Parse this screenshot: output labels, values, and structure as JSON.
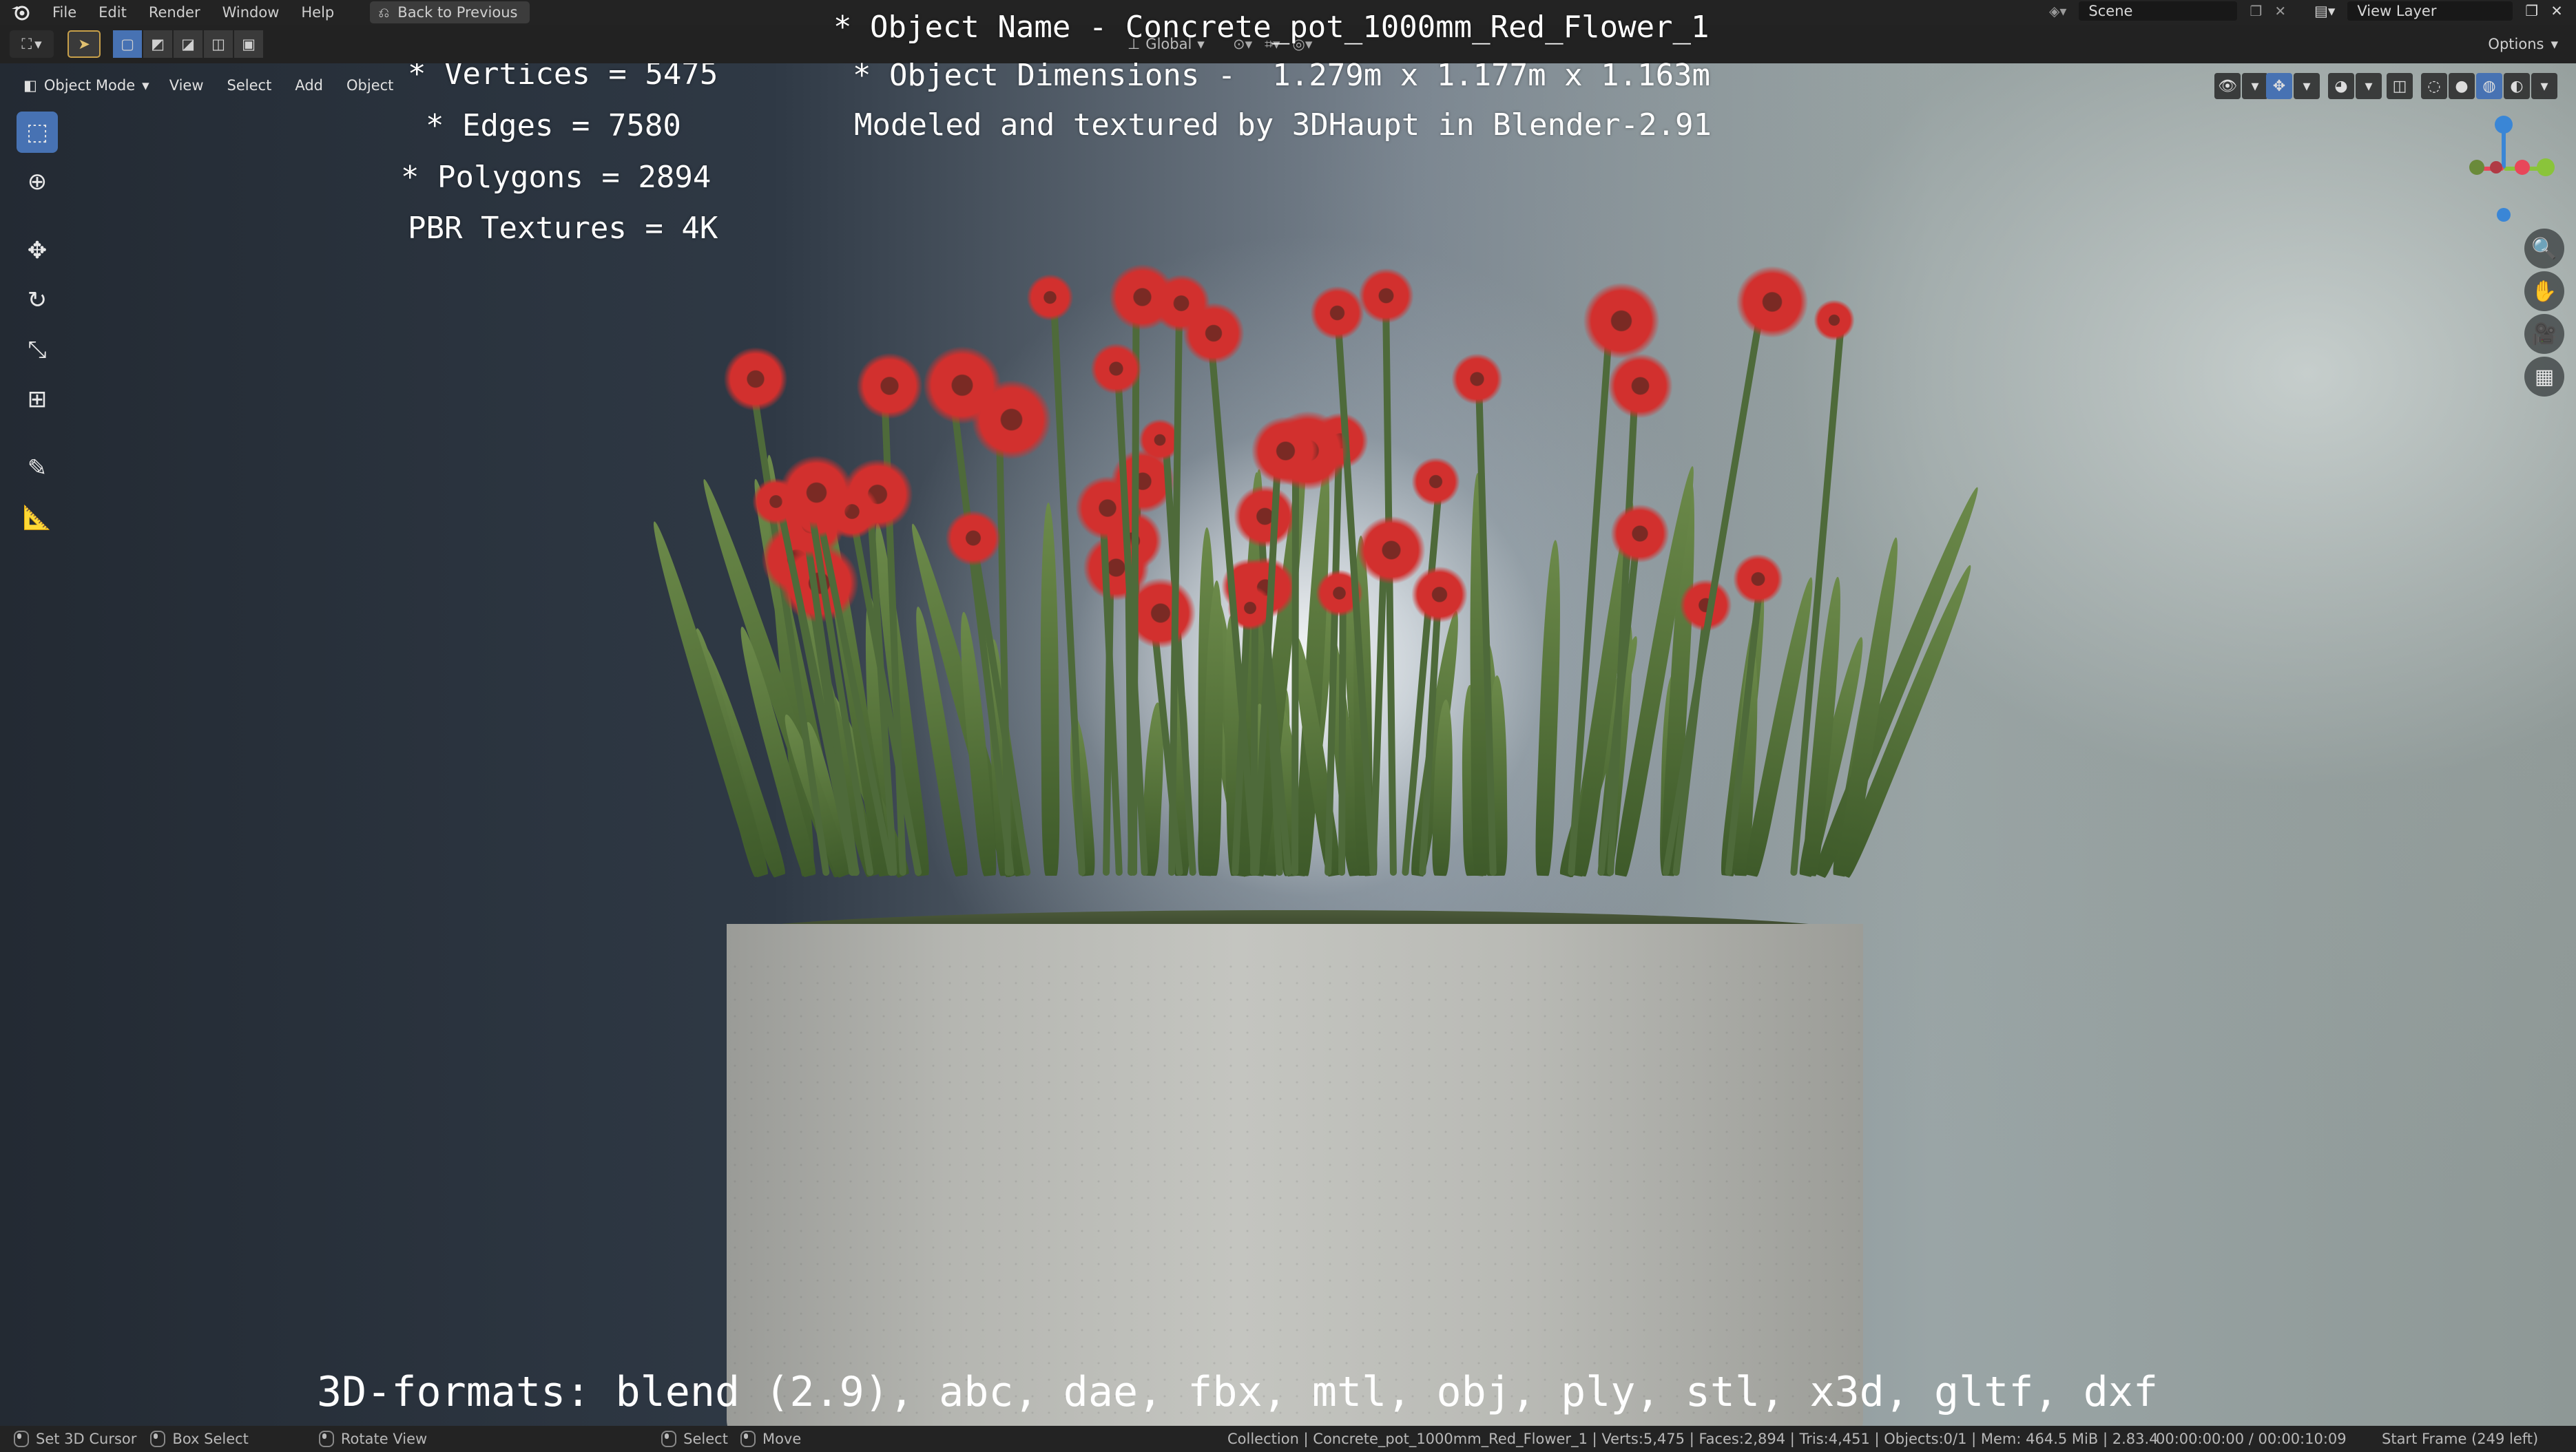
{
  "topbar": {
    "menus": [
      "File",
      "Edit",
      "Render",
      "Window",
      "Help"
    ],
    "back_button": "Back to Previous",
    "scene_name": "Scene",
    "view_layer": "View Layer"
  },
  "header": {
    "transform_orientation": "Global",
    "options_label": "Options"
  },
  "viewport": {
    "mode_label": "Object Mode",
    "menus": [
      "View",
      "Select",
      "Add",
      "Object"
    ]
  },
  "overlay_text": {
    "vertices": "* Vertices = 5475",
    "edges": "* Edges = 7580",
    "polygons": "* Polygons = 2894",
    "textures": "PBR Textures = 4K",
    "object_name": "* Object Name - Concrete_pot_1000mm_Red_Flower_1",
    "object_dimensions": "* Object Dimensions -  1.279m x 1.177m x 1.163m",
    "modeled_by": "Modeled and textured by 3DHaupt in Blender-2.91",
    "formats": "3D-formats: blend (2.9), abc, dae, fbx, mtl, obj, ply, stl, x3d, gltf, dxf"
  },
  "statusbar": {
    "set_cursor": "Set 3D Cursor",
    "box_select": "Box Select",
    "rotate_view": "Rotate View",
    "select": "Select",
    "move": "Move",
    "stats": "Collection | Concrete_pot_1000mm_Red_Flower_1 | Verts:5,475 | Faces:2,894 | Tris:4,451 | Objects:0/1 | Mem: 464.5 MiB | 2.83.4",
    "time": "00:00:00:00 / 00:00:10:09",
    "frame": "Start Frame (249 left)"
  },
  "icons": {
    "blender_logo": "blender-logo-icon",
    "tools": [
      "select-box-icon",
      "cursor-icon",
      "move-icon",
      "rotate-icon",
      "scale-icon",
      "transform-icon",
      "annotate-icon",
      "measure-icon"
    ],
    "nav": [
      "zoom-icon",
      "pan-icon",
      "camera-icon",
      "grid-icon"
    ]
  },
  "colors": {
    "accent": "#4772b3",
    "flower_red": "#d2302e",
    "axis_x": "#e8475a",
    "axis_y": "#8ac43a",
    "axis_z": "#3a86d6"
  }
}
